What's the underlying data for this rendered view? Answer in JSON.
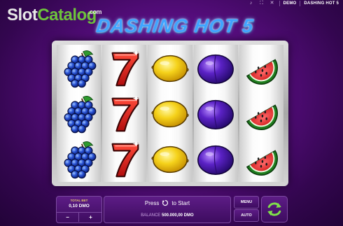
{
  "watermark": {
    "slot": "Slot",
    "catalog": "Catalog",
    "com": ".com"
  },
  "topbar": {
    "mode": "DEMO",
    "game": "DASHING HOT 5",
    "icons": [
      "sound-icon",
      "fullscreen-icon",
      "settings-icon"
    ]
  },
  "title": "DASHING HOT 5",
  "reels": [
    [
      "grapes",
      "grapes",
      "grapes"
    ],
    [
      "seven",
      "seven",
      "seven"
    ],
    [
      "lemon",
      "lemon",
      "lemon"
    ],
    [
      "plum",
      "plum",
      "plum"
    ],
    [
      "watermelon",
      "watermelon",
      "watermelon"
    ]
  ],
  "bet": {
    "label": "TOTAL BET",
    "value": "0,10 DMO",
    "minus": "−",
    "plus": "+"
  },
  "start": {
    "press": "Press",
    "to_start": "to Start"
  },
  "balance": {
    "label": "BALANCE",
    "value": "500.000,00 DMO"
  },
  "buttons": {
    "menu": "MENU",
    "auto": "AUTO"
  },
  "colors": {
    "accent": "#6dc23c",
    "title": "#3fa4ff",
    "background": "#5a0e83"
  }
}
